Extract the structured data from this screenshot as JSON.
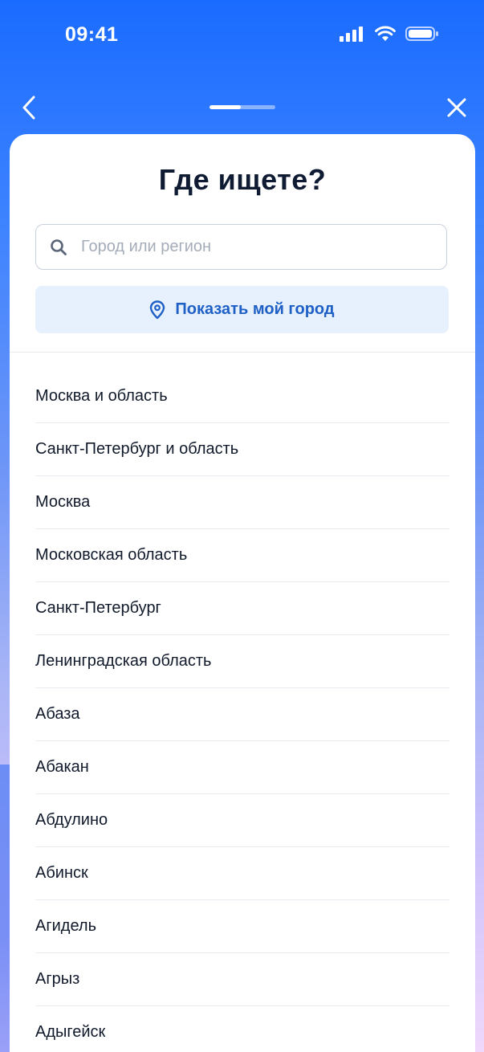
{
  "status_bar": {
    "time": "09:41"
  },
  "nav": {
    "progress": 0.48
  },
  "sheet": {
    "title": "Где ищете?",
    "search": {
      "placeholder": "Город или регион",
      "value": ""
    },
    "show_city_button": {
      "label": "Показать мой город"
    },
    "cities": [
      "Москва и область",
      "Санкт-Петербург и область",
      "Москва",
      "Московская область",
      "Санкт-Петербург",
      "Ленинградская область",
      "Абаза",
      "Абакан",
      "Абдулино",
      "Абинск",
      "Агидель",
      "Агрыз",
      "Адыгейск"
    ]
  },
  "colors": {
    "accent": "#1e60c6",
    "button_bg": "#e7f0fd",
    "header_gradient_top": "#1a6bff"
  },
  "icons": {
    "back": "chevron-left-icon",
    "close": "close-icon",
    "search": "search-icon",
    "location": "location-pin-icon",
    "signal": "signal-icon",
    "wifi": "wifi-icon",
    "battery": "battery-icon"
  }
}
